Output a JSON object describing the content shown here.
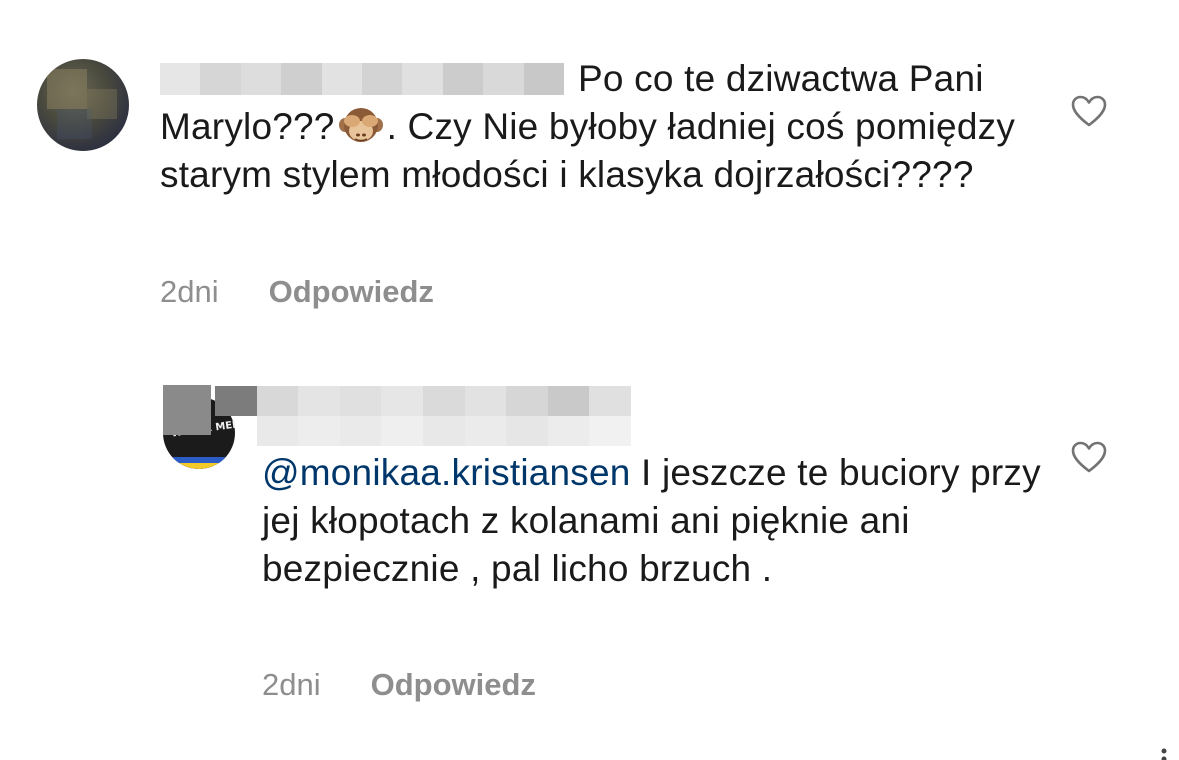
{
  "comments": [
    {
      "text_before_emoji": "Po co te dziwactwa Pani Marylo???",
      "emoji": "see-no-evil-monkey",
      "text_after_emoji": ". Czy Nie byłoby ładniej coś pomiędzy starym stylem młodości i klasyka dojrzałości????",
      "time": "2dni",
      "reply_label": "Odpowiedz",
      "like_icon": "heart-outline-icon"
    },
    {
      "mention": "@monikaa.kristiansen",
      "text": " I jeszcze te buciory przy jej kłopotach z kolanami ani pięknie ani bezpiecznie , pal licho brzuch .",
      "avatar_logo_text": "WOLNE MEDIA",
      "time": "2dni",
      "reply_label": "Odpowiedz",
      "like_icon": "heart-outline-icon"
    }
  ],
  "colors": {
    "text": "#262626",
    "meta": "#8e8e8e",
    "mention": "#00376b"
  }
}
